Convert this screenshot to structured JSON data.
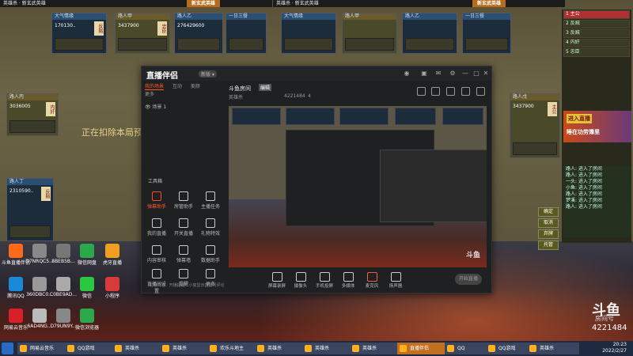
{
  "game": {
    "left_window_title": "英雄杀 · 新玄武英雄",
    "right_window_title": "英雄杀 · 新玄武英雄",
    "banner_left": "新玄武英雄",
    "banner_right": "新玄武英雄",
    "overlay_text": "正在扣除本局预",
    "players": [
      {
        "num": "170130..",
        "role": "反贼"
      },
      {
        "num": "3437900",
        "role": "忠臣"
      },
      {
        "num": "276429600",
        "role": ""
      },
      {
        "num": "3036005",
        "role": "内奸"
      },
      {
        "num": "2310590..",
        "role": "反贼"
      },
      {
        "num": "3437900",
        "role": "主公"
      }
    ]
  },
  "right_panel": {
    "rows": [
      "1 主公",
      "2 反贼",
      "3 反贼",
      "4 内奸",
      "5 忠臣"
    ],
    "promo_badge": "进入直播",
    "promo_text": "睡在功劳簿里",
    "chat_lines": [
      "路人: 进入了房间",
      "路人: 进入了房间",
      "一头: 进入了房间",
      "小鱼: 进入了房间",
      "路人: 进入了房间",
      "梦溪: 进入了房间",
      "路人: 进入了房间"
    ],
    "side_buttons": [
      "确定",
      "取消",
      "弃牌",
      "托管"
    ]
  },
  "obs_app": {
    "logo": "直播伴侣",
    "version": "新版 ▾",
    "tabs": [
      "我的场景",
      "互动",
      "美颜",
      "更多"
    ],
    "scene_label": "场景 1",
    "tools_title": "工具箱",
    "tools": [
      "弹幕助手",
      "房管助手",
      "主播任务",
      "我的直播",
      "开关直播",
      "礼物特效",
      "内容审核",
      "弹幕墙",
      "数据助手",
      "直播间设置",
      "提醒",
      "更多"
    ],
    "bottom_note": "礼物日志 · 开播提醒 · 小窗显示直播间评论",
    "room_title": "斗鱼房间",
    "room_tag": "编辑",
    "room_sub": "英雄杀",
    "room_id": "4221484",
    "room_fans": "4",
    "controls": [
      "屏幕录屏",
      "摄像头",
      "手机投屏",
      "多媒体",
      "麦克风",
      "扬声器"
    ],
    "start_button": "开始直播"
  },
  "preview": {
    "watermark": "斗鱼"
  },
  "desktop": {
    "icons": [
      {
        "label": "斗鱼直播伴侣",
        "color": "#ff6a1a"
      },
      {
        "label": "D7NRQC5...",
        "color": "#888888"
      },
      {
        "label": "8BEB5B...",
        "color": "#777777"
      },
      {
        "label": "微信网盘",
        "color": "#2aa84a"
      },
      {
        "label": "虎牙直播",
        "color": "#f0a020"
      },
      {
        "label": "腾讯QQ",
        "color": "#1a8ad8"
      },
      {
        "label": "360DBC0...",
        "color": "#999999"
      },
      {
        "label": "C0BE9AD...",
        "color": "#aaaaaa"
      },
      {
        "label": "微信",
        "color": "#2ac840"
      },
      {
        "label": "小程序",
        "color": "#d83a3a"
      },
      {
        "label": "网易云音乐",
        "color": "#d8202a"
      },
      {
        "label": "6AD4NG...",
        "color": "#bbbbbb"
      },
      {
        "label": "D79UN9Y...",
        "color": "#888888"
      },
      {
        "label": "微信浏览器",
        "color": "#2aa84a"
      }
    ],
    "logo": "斗鱼",
    "logo_sub": "房间号",
    "room_number": "4221484"
  },
  "taskbar": {
    "items": [
      "网易云音乐",
      "QQ游戏",
      "英雄杀",
      "英雄杀",
      "欢乐斗地主",
      "英雄杀",
      "英雄杀",
      "英雄杀",
      "直播伴侣",
      "QQ",
      "QQ游戏",
      "英雄杀"
    ],
    "active_index": 8,
    "clock_time": "20:23",
    "clock_date": "2022/2/27"
  }
}
